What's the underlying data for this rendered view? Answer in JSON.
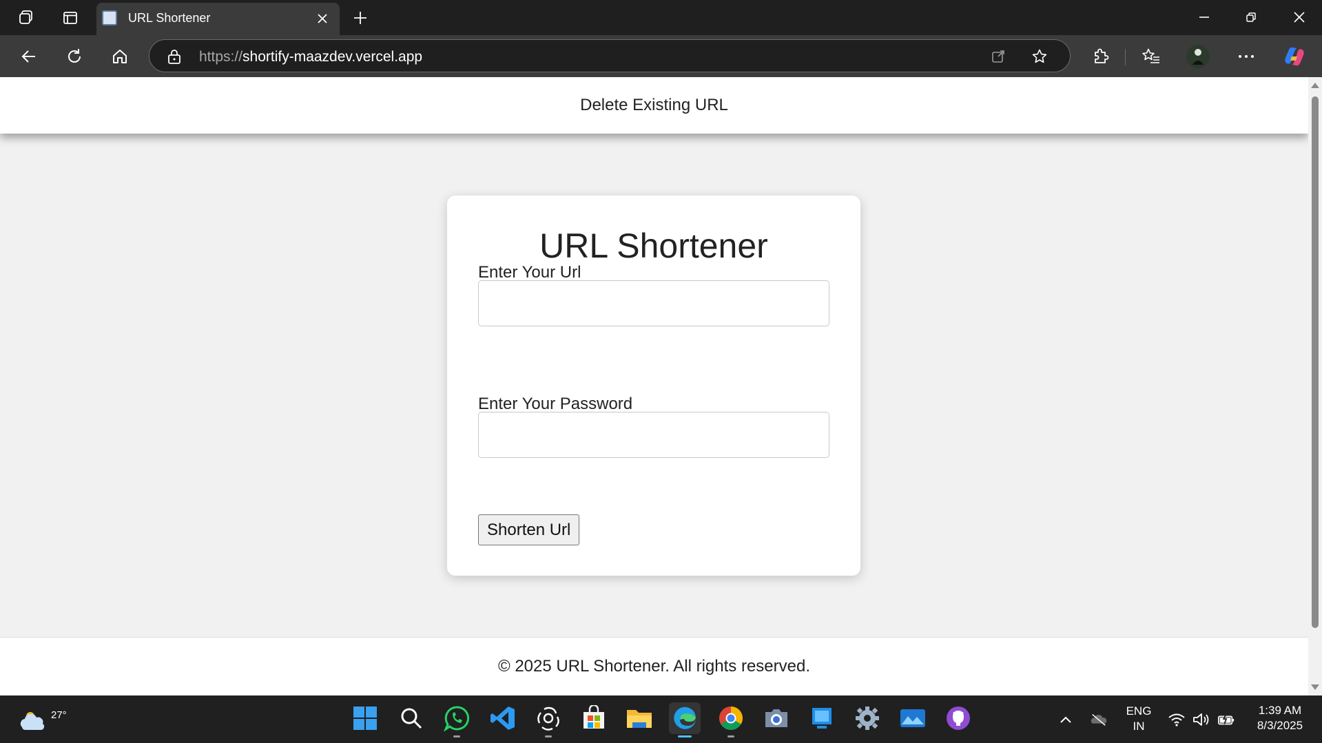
{
  "browser": {
    "tab_title": "URL Shortener",
    "url_protocol": "https://",
    "url_host": "shortify-maazdev.vercel.app"
  },
  "page": {
    "nav_link": "Delete Existing URL",
    "card_title": "URL Shortener",
    "url_label": "Enter Your Url",
    "url_value": "",
    "password_label": "Enter Your Password",
    "password_value": "",
    "submit_label": "Shorten Url",
    "footer": "© 2025 URL Shortener. All rights reserved."
  },
  "taskbar": {
    "weather_temp": "27°",
    "apps": [
      "start",
      "search",
      "whatsapp",
      "vscode",
      "chatgpt",
      "microsoft-store",
      "file-explorer",
      "edge",
      "chrome",
      "camera",
      "remote-desktop",
      "settings",
      "photos",
      "github-desktop"
    ],
    "language_line1": "ENG",
    "language_line2": "IN",
    "time": "1:39 AM",
    "date": "8/3/2025"
  },
  "colors": {
    "page_bg": "#f1f1f1",
    "chrome_dark": "#1f1f1f",
    "toolbar": "#3b3b3b",
    "accent": "#4cc2ff"
  }
}
